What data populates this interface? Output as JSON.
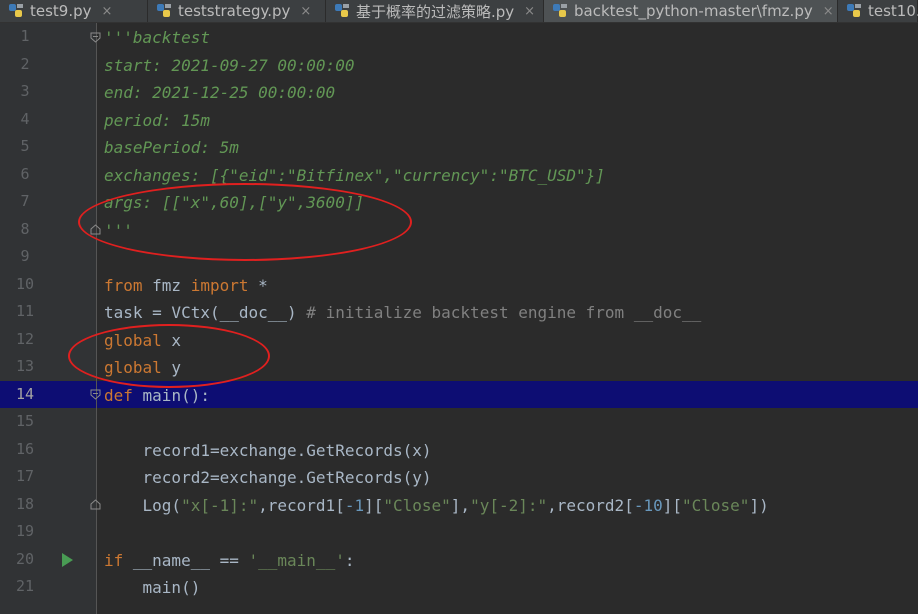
{
  "tabs": [
    {
      "label": "test9.py",
      "close": "×"
    },
    {
      "label": "teststrategy.py",
      "close": "×"
    },
    {
      "label": "基于概率的过滤策略.py",
      "close": "×"
    },
    {
      "label": "backtest_python-master\\fmz.py",
      "close": "×"
    },
    {
      "label": "test10."
    }
  ],
  "editor": {
    "current_line": 14,
    "line_numbers": [
      "1",
      "2",
      "3",
      "4",
      "5",
      "6",
      "7",
      "8",
      "9",
      "10",
      "11",
      "12",
      "13",
      "14",
      "15",
      "16",
      "17",
      "18",
      "19",
      "20",
      "21"
    ],
    "lines": {
      "l1": "'''backtest",
      "l2": "start: 2021-09-27 00:00:00",
      "l3": "end: 2021-12-25 00:00:00",
      "l4": "period: 15m",
      "l5": "basePeriod: 5m",
      "l6": "exchanges: [{\"eid\":\"Bitfinex\",\"currency\":\"BTC_USD\"}]",
      "l7": "args: [[\"x\",60],[\"y\",3600]]",
      "l8": "'''",
      "l10": {
        "from": "from",
        "mod": " fmz ",
        "import": "import",
        "star": " *"
      },
      "l11": {
        "code": "task = VCtx(__doc__) ",
        "comment": "# initialize backtest engine from __doc__"
      },
      "l12": {
        "kw": "global",
        "var": " x"
      },
      "l13": {
        "kw": "global",
        "var": " y"
      },
      "l14": {
        "kw": "def",
        "rest": " main():"
      },
      "l16": "    record1=exchange.GetRecords(x)",
      "l17": "    record2=exchange.GetRecords(y)",
      "l18": {
        "a": "    Log(",
        "s1": "\"x[-1]:\"",
        "b": ",record1[",
        "n1": "-1",
        "c": "][",
        "s2": "\"Close\"",
        "d": "],",
        "s3": "\"y[-2]:\"",
        "e": ",record2[",
        "n2": "-10",
        "f": "][",
        "s4": "\"Close\"",
        "g": "])"
      },
      "l20": {
        "kw": "if",
        "mid": " __name__ == ",
        "str": "'__main__'",
        "end": ":"
      },
      "l21": "    main()"
    }
  },
  "colors": {
    "background": "#2b2b2b",
    "current_line_highlight": "#0d0d73",
    "keyword": "#cc7832",
    "docstring": "#629755",
    "string": "#6a8759",
    "number": "#6897bb",
    "annotation": "#e0201f"
  },
  "icons": {
    "tab": "python-file-icon",
    "run": "run-arrow-icon",
    "fold": "fold-marker-icon"
  }
}
